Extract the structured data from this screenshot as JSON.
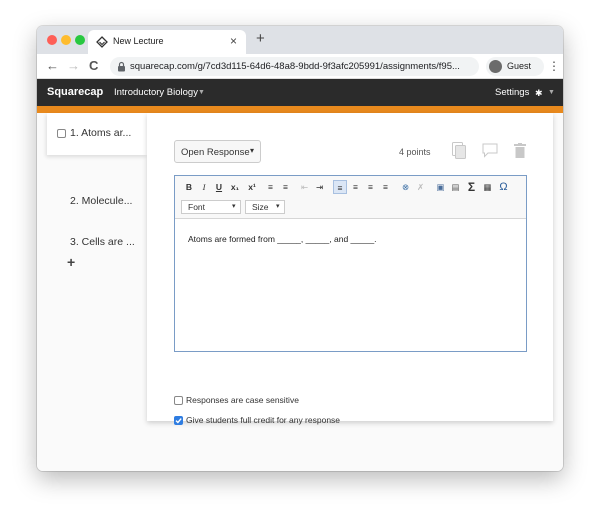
{
  "browser": {
    "tab_title": "New Lecture",
    "tab_close": "×",
    "new_tab": "+",
    "url": "squarecap.com/g/7cd3d115-64d6-48a8-9bdd-9f3afc205991/assignments/f95...",
    "profile_label": "Guest",
    "back": "←",
    "forward": "→",
    "reload": "C",
    "menu": "⋮"
  },
  "appnav": {
    "brand": "Squarecap",
    "course": "Introductory Biology",
    "settings": "Settings",
    "settings_glyph": "✱",
    "caret": "▼"
  },
  "colors": {
    "accent": "#e8891d",
    "nav_bg": "#2b2b2b",
    "checkbox_checked": "#2f7de1",
    "editor_border": "#7a9cc6"
  },
  "sidebar": {
    "items": [
      {
        "label": "1. Atoms ar...",
        "active": true
      },
      {
        "label": "2. Molecule..."
      },
      {
        "label": "3. Cells are ..."
      }
    ],
    "add_label": "+"
  },
  "question": {
    "type_label": "Open Response",
    "type_caret": "▾",
    "points": "4 points",
    "icons": [
      "duplicate-icon",
      "comment-icon",
      "trash-icon"
    ]
  },
  "toolbar": {
    "bold": "B",
    "italic": "I",
    "underline": "U",
    "subscript": "x₁",
    "superscript": "x¹",
    "ordered_list": "≡",
    "unordered_list": "≡",
    "outdent": "⇤",
    "indent": "⇥",
    "align_left": "≡",
    "align_center": "≡",
    "align_right": "≡",
    "align_justify": "≡",
    "link": "⊗",
    "unlink": "✗",
    "image": "▣",
    "flash": "▤",
    "sum": "Σ",
    "table": "▦",
    "omega": "Ω",
    "font_label": "Font",
    "size_label": "Size",
    "select_caret": "▾"
  },
  "editor": {
    "content": "Atoms are formed from _____, _____, and _____."
  },
  "options": [
    {
      "label": "Responses are case sensitive",
      "checked": false
    },
    {
      "label": "Give students full credit for any response",
      "checked": true
    }
  ]
}
